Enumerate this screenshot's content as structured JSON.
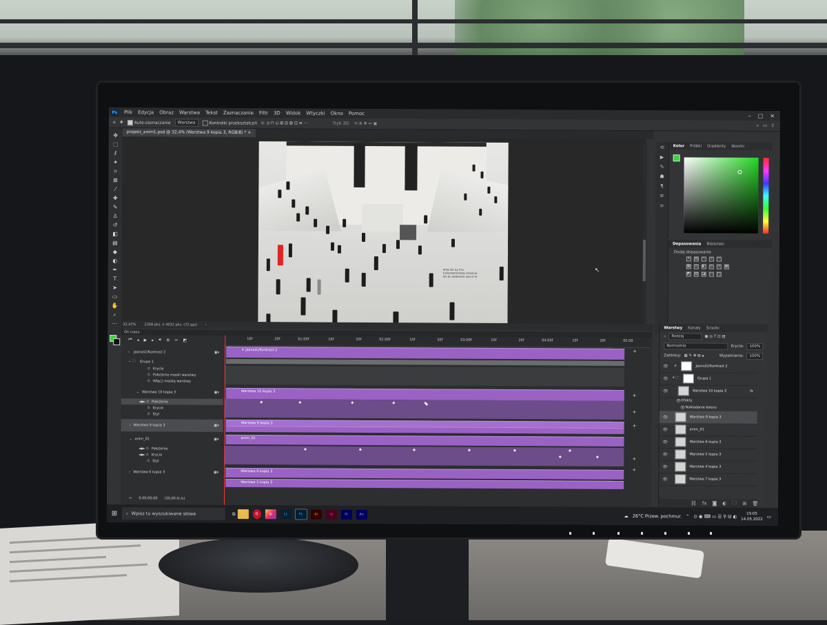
{
  "app": {
    "logo": "Ps",
    "menu": [
      "Plik",
      "Edycja",
      "Obraz",
      "Warstwa",
      "Tekst",
      "Zaznaczanie",
      "Filtr",
      "3D",
      "Widok",
      "Wtyczki",
      "Okno",
      "Pomoc"
    ],
    "window_controls": [
      "–",
      "□",
      "✕"
    ]
  },
  "options_bar": {
    "auto_select_label": "Auto-zaznaczanie",
    "layer_select_value": "Warstwa",
    "transform_controls_label": "Kontrolki przekształceń",
    "mode_3d_label": "Tryb 3D:"
  },
  "document": {
    "tab_title": "projekt_anim1.psd @ 32,4% (Warstwa 9 kopia 3, RGB/8) *",
    "zoom": "32,42%",
    "dimensions": "2268 pks. x 4032 pks. (72 ppi)",
    "caption_lines": [
      "ama laii ay hsu",
      "tuiliareemimaas ereieiue",
      "eis eu aeieereni osa ol in"
    ]
  },
  "color_panel": {
    "tabs": [
      "Kolor",
      "Próbki",
      "Gradienty",
      "Wzorki"
    ],
    "active_tab": "Kolor",
    "foreground": "#3bd43b",
    "background": "#111111"
  },
  "adjustments_panel": {
    "tabs": [
      "Dopasowania",
      "Biblioteki"
    ],
    "title": "Dodaj dopasowanie"
  },
  "layers_panel": {
    "tabs": [
      "Warstwy",
      "Kanały",
      "Ścieżki"
    ],
    "filter_label": "Rodzaj",
    "blend_mode": "Normalnie",
    "opacity_label": "Krycie:",
    "opacity_value": "100%",
    "lock_label": "Zablokuj:",
    "fill_label": "Wypełnienie:",
    "fill_value": "100%",
    "layers": [
      {
        "name": "Jasność/Kontrast 2",
        "type": "adjustment"
      },
      {
        "name": "Grupa 1",
        "type": "group"
      },
      {
        "name": "Warstwa 10 kopia 3",
        "type": "layer",
        "fx": "fx"
      },
      {
        "name": "Efekty",
        "type": "effect"
      },
      {
        "name": "Nakładanie koloru",
        "type": "effect"
      },
      {
        "name": "Warstwa 9 kopia 3",
        "type": "layer",
        "selected": true
      },
      {
        "name": "anim_01",
        "type": "layer"
      },
      {
        "name": "Warstwa 6 kopia 3",
        "type": "layer"
      },
      {
        "name": "Warstwa 5 kopia 3",
        "type": "layer"
      },
      {
        "name": "Warstwa 4 kopia 3",
        "type": "layer"
      },
      {
        "name": "Warstwa 7 kopia 3",
        "type": "layer"
      }
    ],
    "footer_icons": [
      "link-icon",
      "fx-icon",
      "mask-icon",
      "adjust-icon",
      "folder-icon",
      "new-layer-icon",
      "trash-icon"
    ]
  },
  "timeline": {
    "title": "Oś czasu",
    "ruler": [
      "10f",
      "20f",
      "01:00f",
      "10f",
      "20f",
      "02:00f",
      "10f",
      "20f",
      "03:00f",
      "10f",
      "20f",
      "04:00f",
      "10f",
      "20f",
      "05:00"
    ],
    "current_time": "0:00:00:00",
    "fps": "(30,00 kl./s)",
    "tracks": [
      {
        "label": "Jasność/Kontrast 2",
        "bar": "Jasność/Kontrast 2"
      },
      {
        "label": "Grupa 1"
      },
      {
        "label": "Krycie"
      },
      {
        "label": "Położenie maski warstwy"
      },
      {
        "label": "Włącz maskę warstwy"
      },
      {
        "label": "Warstwa 10 kopia 3",
        "bar": "Warstwa 10 kopia 3"
      },
      {
        "label": "Położenie"
      },
      {
        "label": "Krycie"
      },
      {
        "label": "Styl"
      },
      {
        "label": "Warstwa 9 kopia 3",
        "bar": "Warstwa 9 kopia 3"
      },
      {
        "label": "anim_01",
        "bar": "anim_01"
      },
      {
        "label": "Położenie"
      },
      {
        "label": "Krycie"
      },
      {
        "label": "Styl"
      },
      {
        "label": "Warstwa 6 kopia 3",
        "bar": "Warstwa 6 kopia 3"
      },
      {
        "label": "",
        "bar": "Warstwa 5 kopia 3"
      }
    ]
  },
  "taskbar": {
    "search_placeholder": "Wpisz tu wyszukiwane słowa",
    "apps": [
      {
        "label": "Lr",
        "color": "#0a1f33",
        "fg": "#31a8ff"
      },
      {
        "label": "Ps",
        "color": "#001e36",
        "fg": "#31a8ff"
      },
      {
        "label": "Ai",
        "color": "#330000",
        "fg": "#ff9a00"
      },
      {
        "label": "Id",
        "color": "#49021f",
        "fg": "#ff3366"
      },
      {
        "label": "Fr",
        "color": "#00005b",
        "fg": "#9999ff"
      },
      {
        "label": "An",
        "color": "#00005b",
        "fg": "#9999ff"
      }
    ],
    "weather": "26°C  Przew. pochmur.",
    "time": "15:05",
    "date": "14.05.2022"
  }
}
